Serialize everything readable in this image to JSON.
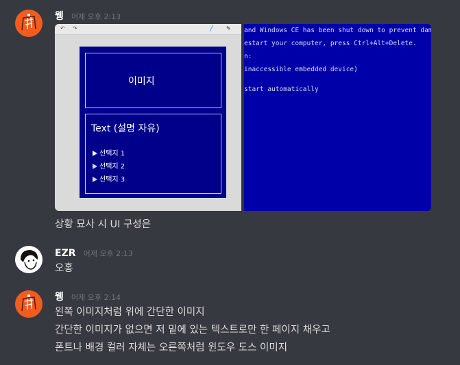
{
  "messages": [
    {
      "username": "웽",
      "timestamp": "어제 오후 2:13",
      "lines": [
        "상황 묘사 시 UI 구성은"
      ]
    },
    {
      "username": "EZR",
      "timestamp": "어제 오후 2:13",
      "lines": [
        "오홍"
      ]
    },
    {
      "username": "웽",
      "timestamp": "어제 오후 2:14",
      "lines": [
        "왼쪽 이미지처럼 위에 간단한 이미지",
        "간단한 이미지가 없으면 저 밑에 있는 텍스트로만 한 페이지 채우고",
        "폰트나 배경 컬러 자체는 오른쪽처럼 윈도우 도스 이미지"
      ]
    }
  ],
  "attachment": {
    "sketch": {
      "image_label": "이미지",
      "text_label": "Text  (설명 자유)",
      "choices": [
        "선택지 1",
        "선택지 2",
        "선택지 3"
      ]
    },
    "bsod": {
      "lines": [
        "and Windows CE has been shut down to prevent damag",
        "estart your computer, press Ctrl+Alt+Delete.",
        "n:",
        "inaccessible embedded device)",
        "start automatically"
      ]
    }
  },
  "colors": {
    "background": "#36393f",
    "avatar_orange": "#f25c1f",
    "dos_blue": "#0000a8"
  }
}
